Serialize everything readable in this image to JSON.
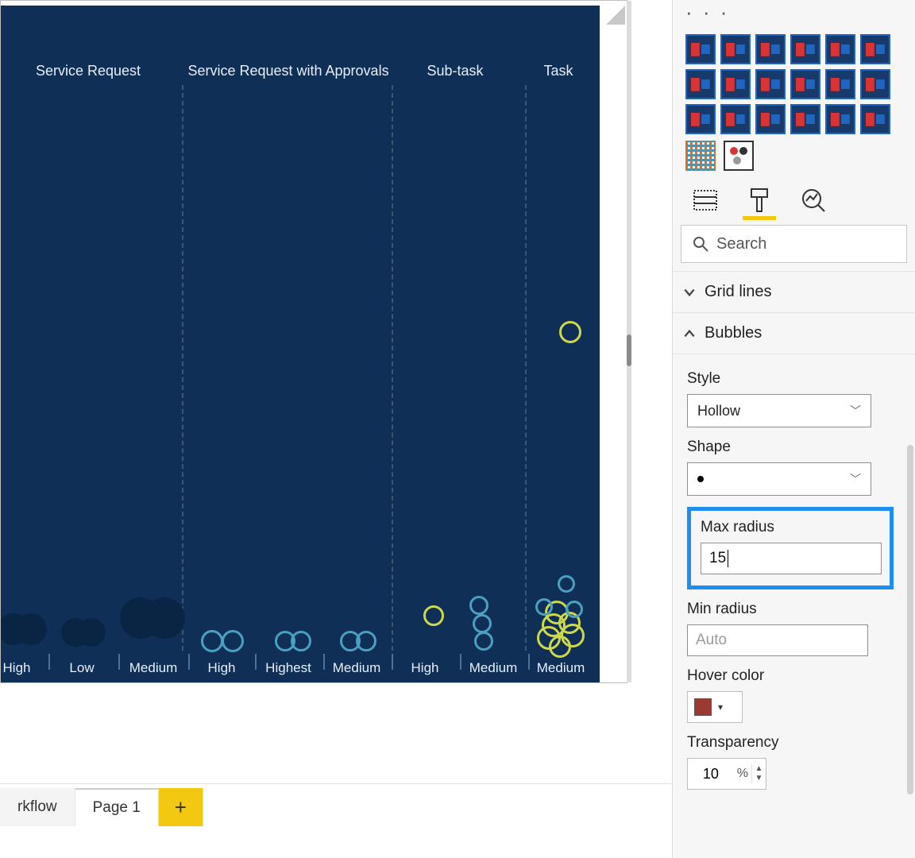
{
  "canvas": {
    "columns": [
      {
        "label": "Service Request",
        "center": 110
      },
      {
        "label": "Service Request with Approvals",
        "center": 362
      },
      {
        "label": "Sub-task",
        "center": 572
      },
      {
        "label": "Task",
        "center": 702
      }
    ],
    "columnDividers": [
      228,
      492,
      660
    ],
    "xTicks": [
      {
        "label": "High",
        "x": 20
      },
      {
        "label": "Low",
        "x": 102
      },
      {
        "label": "Medium",
        "x": 192
      },
      {
        "label": "High",
        "x": 278
      },
      {
        "label": "Highest",
        "x": 362
      },
      {
        "label": "Medium",
        "x": 448
      },
      {
        "label": "High",
        "x": 534
      },
      {
        "label": "Medium",
        "x": 620
      },
      {
        "label": "Medium",
        "x": 705
      }
    ],
    "xSeparators": [
      60,
      148,
      236,
      320,
      406,
      492,
      578,
      664
    ]
  },
  "chart_data": {
    "type": "scatter",
    "title": "",
    "xlabel": "",
    "ylabel": "",
    "note": "bubble positions estimated from pixels; y normalized 0 (bottom axis) to 1 (top of plot); r in px",
    "series": [
      {
        "name": "yellow-hollow",
        "points": [
          {
            "xCategory": "Task / Medium",
            "x": 717,
            "y": 0.565,
            "r": 14
          },
          {
            "xCategory": "Sub-task / High",
            "x": 545,
            "y": 0.065,
            "r": 13
          },
          {
            "xCategory": "Task / Medium",
            "x": 700,
            "y": 0.07,
            "r": 15
          },
          {
            "xCategory": "Task / Medium",
            "x": 696,
            "y": 0.048,
            "r": 15
          },
          {
            "xCategory": "Task / Medium",
            "x": 716,
            "y": 0.052,
            "r": 14
          },
          {
            "xCategory": "Task / Medium",
            "x": 690,
            "y": 0.025,
            "r": 15
          },
          {
            "xCategory": "Task / Medium",
            "x": 720,
            "y": 0.03,
            "r": 15
          },
          {
            "xCategory": "Task / Medium",
            "x": 704,
            "y": 0.01,
            "r": 14
          }
        ]
      },
      {
        "name": "teal-hollow",
        "points": [
          {
            "xCategory": "Sub-task / Medium",
            "x": 602,
            "y": 0.082,
            "r": 12
          },
          {
            "xCategory": "Sub-task / Medium",
            "x": 606,
            "y": 0.05,
            "r": 12
          },
          {
            "xCategory": "Sub-task / Medium",
            "x": 608,
            "y": 0.02,
            "r": 12
          },
          {
            "xCategory": "Task / Medium",
            "x": 712,
            "y": 0.12,
            "r": 11
          },
          {
            "xCategory": "Task / Medium",
            "x": 684,
            "y": 0.08,
            "r": 11
          },
          {
            "xCategory": "Task / Medium",
            "x": 722,
            "y": 0.075,
            "r": 11
          },
          {
            "xCategory": "SRwA / High",
            "x": 266,
            "y": 0.02,
            "r": 14
          },
          {
            "xCategory": "SRwA / High",
            "x": 292,
            "y": 0.02,
            "r": 14
          },
          {
            "xCategory": "SRwA / Highest",
            "x": 358,
            "y": 0.02,
            "r": 13
          },
          {
            "xCategory": "SRwA / Highest",
            "x": 378,
            "y": 0.02,
            "r": 13
          },
          {
            "xCategory": "SRwA / Medium",
            "x": 440,
            "y": 0.02,
            "r": 13
          },
          {
            "xCategory": "SRwA / Medium",
            "x": 460,
            "y": 0.02,
            "r": 13
          }
        ]
      },
      {
        "name": "dark-cluster",
        "points": [
          {
            "xCategory": "SR / High",
            "x": 16,
            "y": 0.04,
            "r": 20
          },
          {
            "xCategory": "SR / High",
            "x": 38,
            "y": 0.04,
            "r": 20
          },
          {
            "xCategory": "SR / Low",
            "x": 94,
            "y": 0.035,
            "r": 18
          },
          {
            "xCategory": "SR / Low",
            "x": 114,
            "y": 0.035,
            "r": 18
          },
          {
            "xCategory": "SR / Medium",
            "x": 176,
            "y": 0.06,
            "r": 26
          },
          {
            "xCategory": "SR / Medium",
            "x": 206,
            "y": 0.06,
            "r": 26
          }
        ]
      }
    ]
  },
  "tabs": {
    "partial": "rkflow",
    "page1": "Page 1"
  },
  "side": {
    "ellipsis": "· · ·",
    "search_placeholder": "Search",
    "sections": {
      "gridlines": "Grid lines",
      "bubbles": "Bubbles"
    },
    "bubbles": {
      "style_label": "Style",
      "style_value": "Hollow",
      "shape_label": "Shape",
      "maxr_label": "Max radius",
      "maxr_value": "15",
      "minr_label": "Min radius",
      "minr_placeholder": "Auto",
      "hover_label": "Hover color",
      "hover_color": "#9b3a33",
      "transparency_label": "Transparency",
      "transparency_value": "10",
      "transparency_unit": "%"
    }
  }
}
